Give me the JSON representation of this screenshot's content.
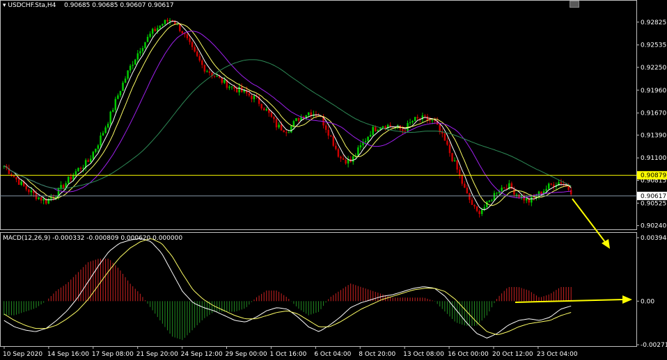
{
  "main_header": {
    "symbol": "USDCHF.Sta,H4",
    "ohlc": "0.90685 0.90685 0.90607 0.90617"
  },
  "macd_header": "MACD(12,26,9) -0.000332 -0.000809 0.000620 0.000000",
  "price_axis": {
    "ticks": [
      "0.92825",
      "0.92535",
      "0.92250",
      "0.91960",
      "0.91670",
      "0.91390",
      "0.91100",
      "0.90815",
      "0.90525",
      "0.90240"
    ],
    "hline_label": "0.90879",
    "bid_label": "0.90617"
  },
  "macd_axis": {
    "ticks": [
      "0.003948",
      "0.00",
      "-0.00271"
    ]
  },
  "time_axis": [
    "10 Sep 2020",
    "14 Sep 16:00",
    "17 Sep 08:00",
    "21 Sep 20:00",
    "24 Sep 12:00",
    "29 Sep 00:00",
    "1 Oct 16:00",
    "6 Oct 04:00",
    "8 Oct 20:00",
    "13 Oct 08:00",
    "16 Oct 00:00",
    "20 Oct 12:00",
    "23 Oct 04:00"
  ],
  "colors": {
    "background": "#000000",
    "bull_candle": "#00cc00",
    "bear_candle": "#cc0000",
    "ma_fast": "#ffffff",
    "ma_mid": "#ffff66",
    "ma_slow": "#a020f0",
    "ma_long": "#2e8b57",
    "hline": "#ffff00",
    "bid_line": "#8899aa",
    "macd_hist_pos": "#cc2222",
    "macd_hist_neg": "#228b22",
    "macd_line": "#ffffff",
    "signal_line": "#ffff66",
    "arrow": "#ffff00",
    "frame": "#c0c0c0"
  },
  "chart_data": [
    {
      "type": "candlestick",
      "title": "USDCHF.Sta,H4",
      "ylim": [
        0.9021,
        0.93
      ],
      "price_path": [
        0.91,
        0.9085,
        0.9072,
        0.9062,
        0.9055,
        0.9065,
        0.908,
        0.9095,
        0.9105,
        0.913,
        0.916,
        0.9195,
        0.9225,
        0.925,
        0.9268,
        0.928,
        0.9287,
        0.927,
        0.9245,
        0.9225,
        0.9215,
        0.9205,
        0.9198,
        0.9192,
        0.9185,
        0.917,
        0.915,
        0.9145,
        0.916,
        0.9168,
        0.9165,
        0.914,
        0.911,
        0.9105,
        0.9125,
        0.9145,
        0.9152,
        0.915,
        0.9145,
        0.9158,
        0.916,
        0.9155,
        0.913,
        0.91,
        0.9065,
        0.904,
        0.905,
        0.907,
        0.9075,
        0.9062,
        0.9055,
        0.9065,
        0.9075,
        0.908,
        0.9068
      ],
      "levels": {
        "horizontal_line": 0.90879,
        "bid": 0.90617
      }
    },
    {
      "type": "line",
      "title": "MACD(12,26,9)",
      "ylim": [
        -0.00271,
        0.003948
      ],
      "macd": [
        -0.0012,
        -0.0016,
        -0.0018,
        -0.0019,
        -0.0017,
        -0.0012,
        -0.0006,
        0.0002,
        0.0012,
        0.0022,
        0.0031,
        0.0036,
        0.0038,
        0.0039,
        0.0037,
        0.003,
        0.0018,
        0.0006,
        -0.0001,
        -0.0004,
        -0.0006,
        -0.0009,
        -0.0012,
        -0.0013,
        -0.001,
        -0.0006,
        -0.0004,
        -0.0005,
        -0.001,
        -0.0016,
        -0.0019,
        -0.0015,
        -0.001,
        -0.0004,
        -0.0001,
        0.0001,
        0.0003,
        0.0004,
        0.0006,
        0.0008,
        0.0009,
        0.0008,
        0.0003,
        -0.0005,
        -0.0013,
        -0.002,
        -0.0023,
        -0.002,
        -0.0015,
        -0.0012,
        -0.0011,
        -0.0012,
        -0.001,
        -0.0005,
        -0.0003
      ],
      "signal": [
        -0.0008,
        -0.0012,
        -0.0015,
        -0.0017,
        -0.0017,
        -0.0015,
        -0.0011,
        -0.0006,
        0.0001,
        0.001,
        0.0019,
        0.0027,
        0.0033,
        0.0037,
        0.0039,
        0.0036,
        0.0028,
        0.0017,
        0.0007,
        0.0001,
        -0.0003,
        -0.0006,
        -0.0009,
        -0.0011,
        -0.0011,
        -0.0009,
        -0.0007,
        -0.0006,
        -0.0008,
        -0.0012,
        -0.0016,
        -0.0016,
        -0.0013,
        -0.0009,
        -0.0005,
        -0.0002,
        0.0001,
        0.0003,
        0.0005,
        0.0007,
        0.0008,
        0.0008,
        0.0006,
        0.0001,
        -0.0006,
        -0.0013,
        -0.0019,
        -0.0021,
        -0.0019,
        -0.0016,
        -0.0014,
        -0.0013,
        -0.0012,
        -0.0009,
        -0.0007
      ]
    }
  ]
}
